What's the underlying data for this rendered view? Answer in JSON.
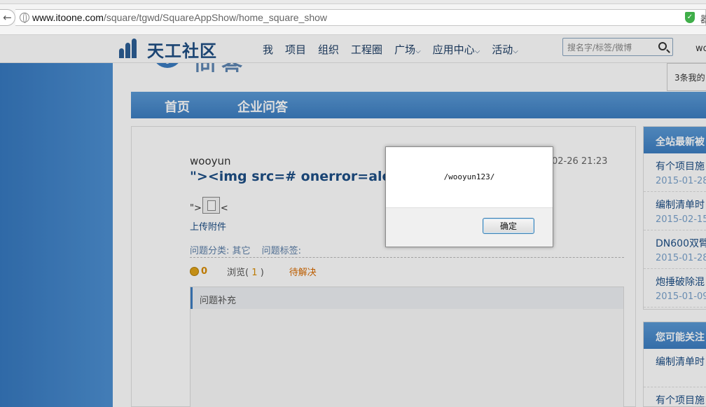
{
  "browser": {
    "url_host": "www.itoone.com",
    "url_path": "/square/tgwd/SquareAppShow/home_square_show",
    "ext_text": "器"
  },
  "nav": {
    "logo_text": "天工社区",
    "items": [
      "我",
      "项目",
      "组织",
      "工程圈",
      "广场",
      "应用中心",
      "活动"
    ],
    "search_placeholder": "搜名字/标签/微博",
    "user": "wo"
  },
  "notice": "3条我的",
  "subnav": [
    "首页",
    "企业问答"
  ],
  "question": {
    "author": "wooyun",
    "title": "\"><img src=# onerror=aler",
    "date": "02-26 21:23",
    "attach_prefix": "\">",
    "attach_suffix": "<",
    "upload_label": "上传附件",
    "category": "问题分类: 其它",
    "tags": "问题标签:",
    "coins": "0",
    "views_label": "浏览(",
    "views_value": "1",
    "views_close": ")",
    "status": "待解决",
    "supplement": "问题补充"
  },
  "sidebar": {
    "box1_title": "全站最新被",
    "items": [
      {
        "title": "有个项目施",
        "date": "2015-01-28"
      },
      {
        "title": "编制清单时",
        "date": "2015-02-15"
      },
      {
        "title": "DN600双臂",
        "date": "2015-01-28"
      },
      {
        "title": "炮捶破除混",
        "date": "2015-01-09"
      }
    ],
    "box2_title": "您可能关注",
    "box2_items": [
      {
        "title": "编制清单时"
      },
      {
        "title": "有个项目施"
      }
    ]
  },
  "dialog": {
    "message": "/wooyun123/",
    "ok": "确定"
  }
}
